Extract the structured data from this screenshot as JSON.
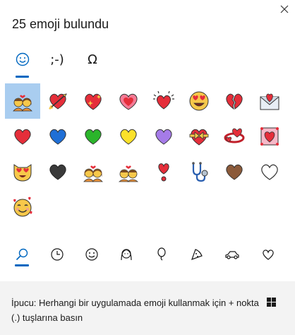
{
  "header": {
    "title": "25 emoji bulundu",
    "close_icon": "close-icon"
  },
  "tabs": [
    {
      "id": "emoji",
      "label": "☺",
      "icon": "smiley-icon",
      "active": true
    },
    {
      "id": "kaomoji",
      "label": ";-)",
      "icon": "kaomoji-icon",
      "active": false
    },
    {
      "id": "symbols",
      "label": "Ω",
      "icon": "omega-icon",
      "active": false
    }
  ],
  "emoji_grid": [
    {
      "icon": "couple-with-heart-emoji",
      "selected": true
    },
    {
      "icon": "heart-with-arrow-emoji"
    },
    {
      "icon": "sparkling-heart-emoji"
    },
    {
      "icon": "growing-heart-emoji"
    },
    {
      "icon": "beating-heart-emoji"
    },
    {
      "icon": "heart-eyes-face-emoji"
    },
    {
      "icon": "broken-heart-emoji"
    },
    {
      "icon": "love-letter-emoji"
    },
    {
      "icon": "red-heart-emoji"
    },
    {
      "icon": "blue-heart-emoji"
    },
    {
      "icon": "green-heart-emoji"
    },
    {
      "icon": "yellow-heart-emoji"
    },
    {
      "icon": "purple-heart-emoji"
    },
    {
      "icon": "heart-with-ribbon-emoji"
    },
    {
      "icon": "revolving-hearts-emoji"
    },
    {
      "icon": "heart-decoration-emoji"
    },
    {
      "icon": "heart-eyes-cat-emoji"
    },
    {
      "icon": "black-heart-emoji"
    },
    {
      "icon": "couple-with-heart-woman-woman-emoji"
    },
    {
      "icon": "couple-with-heart-man-man-emoji"
    },
    {
      "icon": "heart-exclamation-emoji"
    },
    {
      "icon": "stethoscope-emoji"
    },
    {
      "icon": "brown-heart-emoji"
    },
    {
      "icon": "white-heart-emoji"
    },
    {
      "icon": "smiling-face-with-hearts-emoji"
    }
  ],
  "colors": {
    "accent": "#0067c0",
    "selected_bg": "#a9cdf0",
    "footer_bg": "#f3f3f3"
  },
  "bottom_categories": [
    {
      "id": "search",
      "icon": "search-icon",
      "active": true
    },
    {
      "id": "recent",
      "icon": "clock-icon"
    },
    {
      "id": "smileys",
      "icon": "smiley-face-icon"
    },
    {
      "id": "people",
      "icon": "person-icon"
    },
    {
      "id": "celebrations",
      "icon": "balloon-icon"
    },
    {
      "id": "food",
      "icon": "pizza-icon"
    },
    {
      "id": "travel",
      "icon": "car-icon"
    },
    {
      "id": "symbols",
      "icon": "heart-icon"
    }
  ],
  "footer": {
    "tip_text": "İpucu: Herhangi bir uygulamada emoji kullanmak için + nokta (.) tuşlarına basın",
    "windows_key_icon": "windows-logo-icon"
  }
}
